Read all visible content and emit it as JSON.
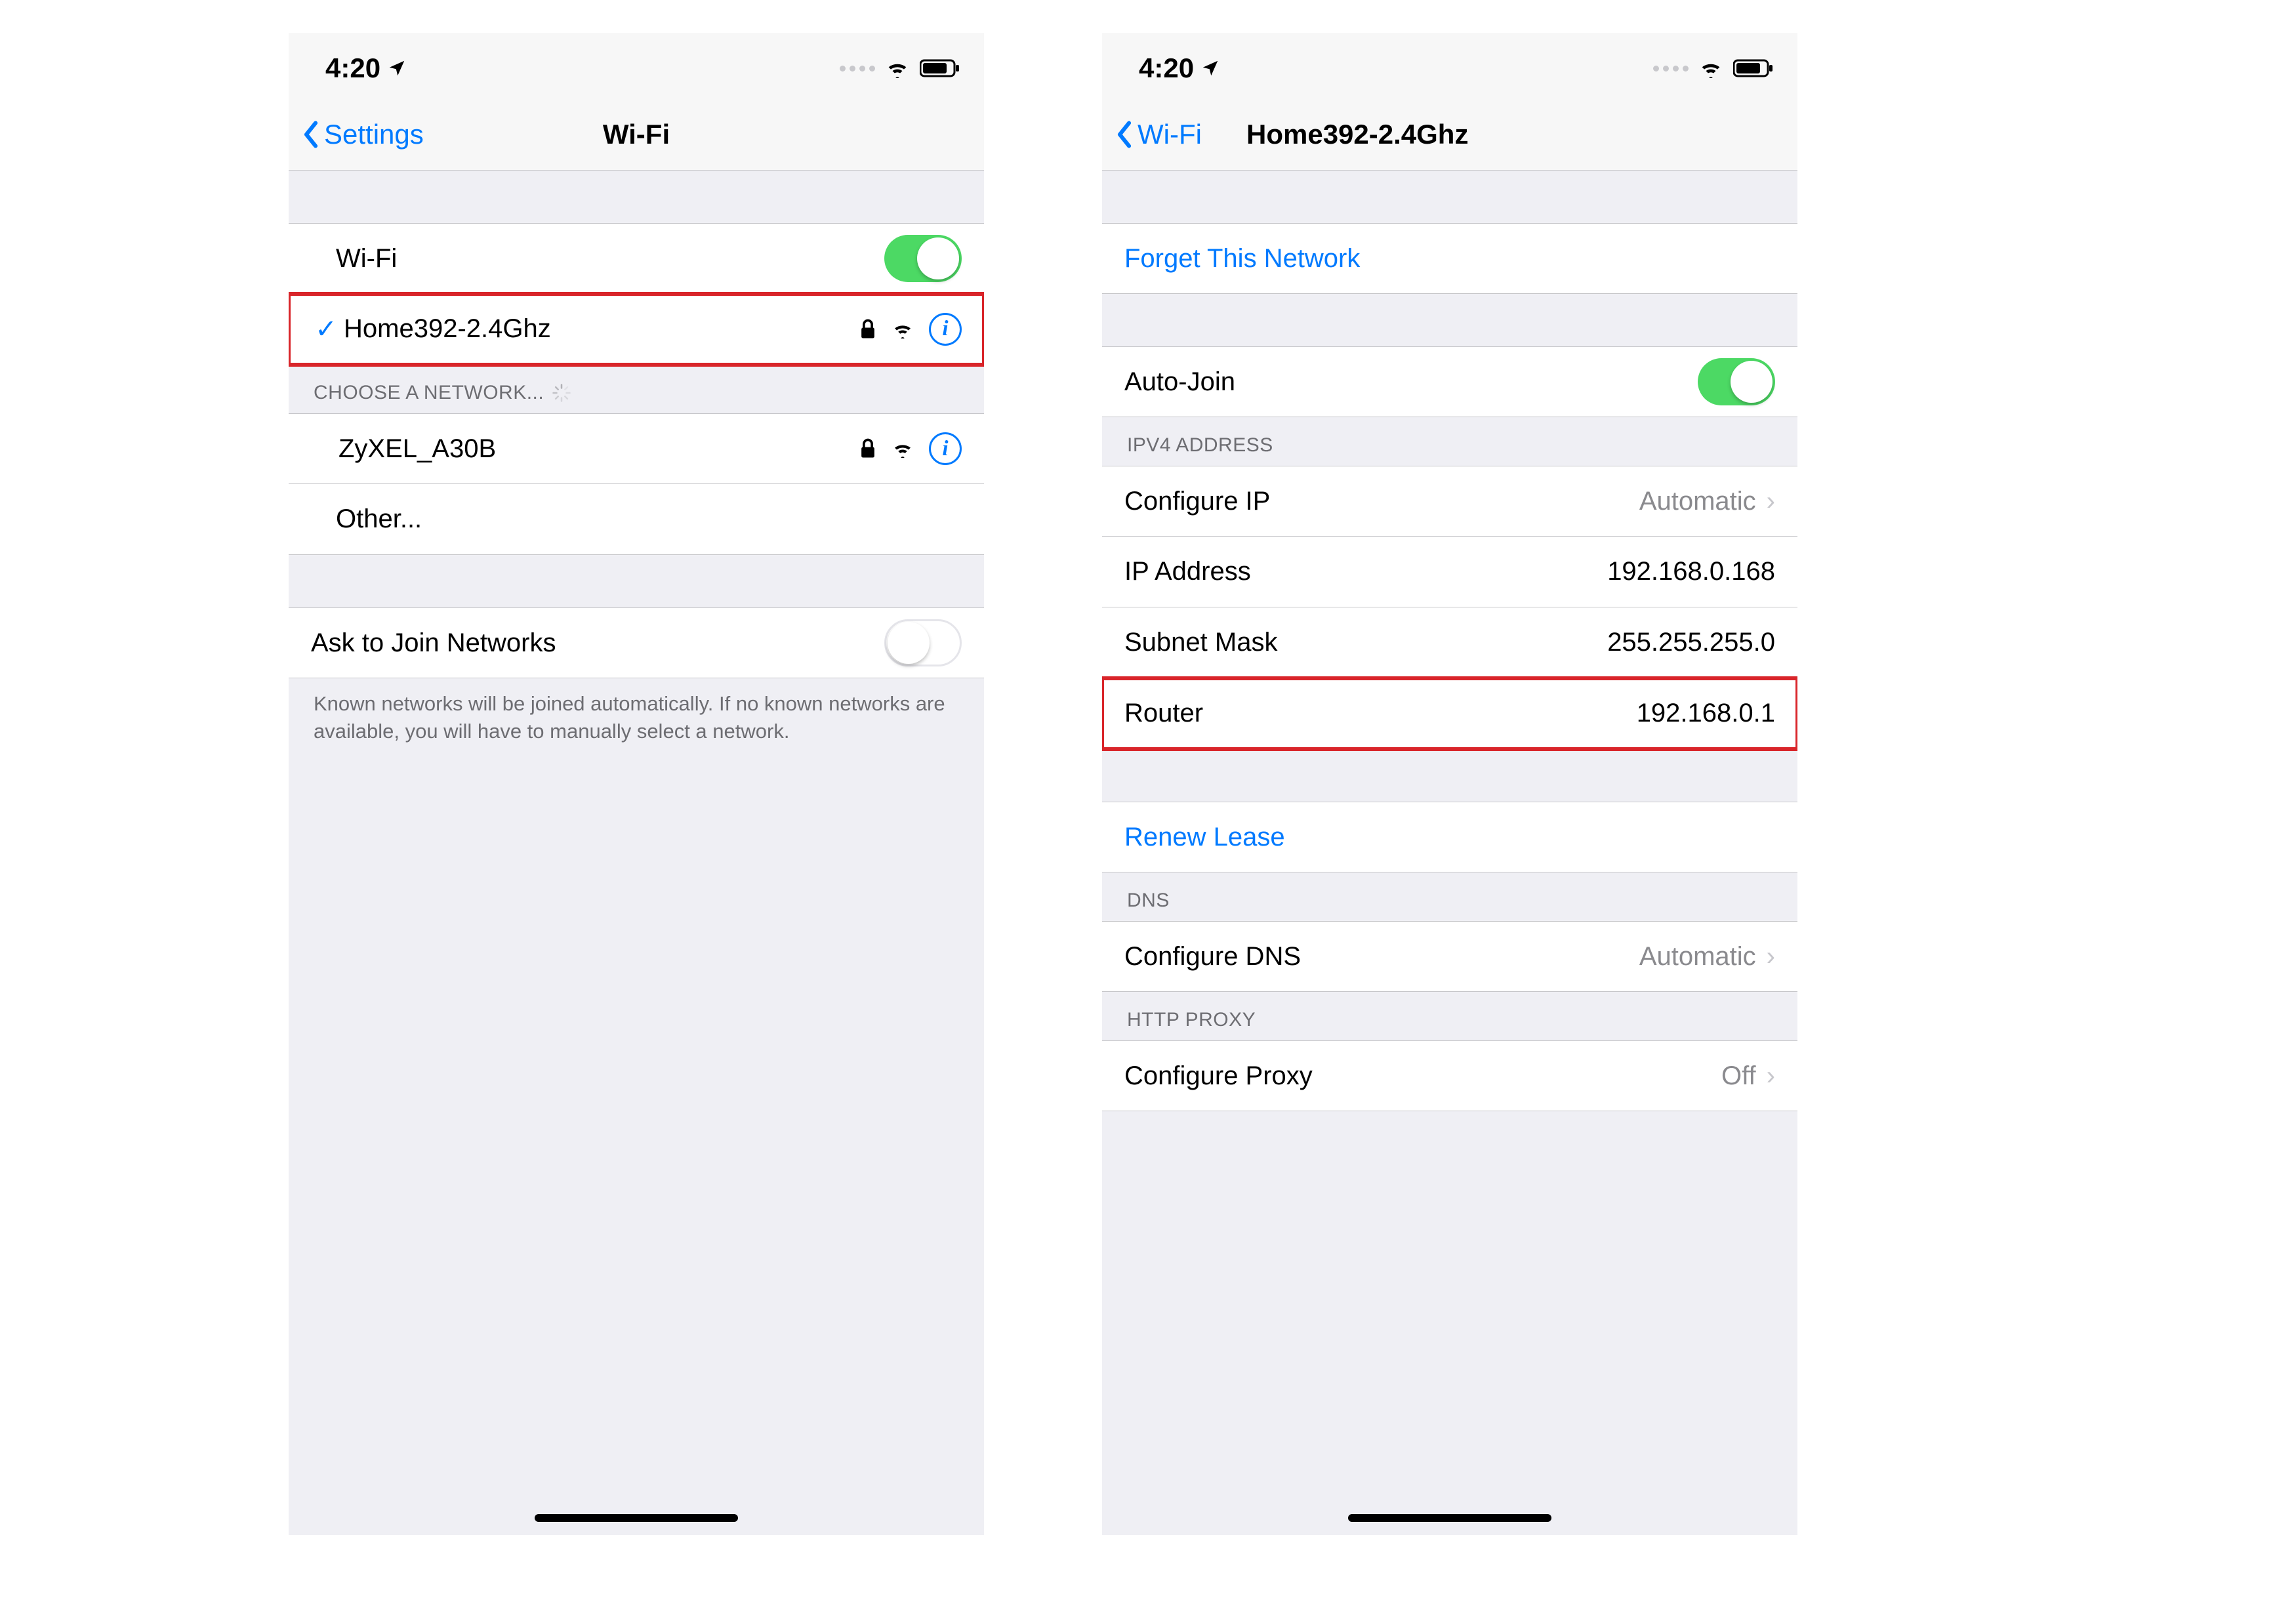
{
  "status": {
    "time": "4:20",
    "location_icon": "location-arrow",
    "wifi_icon": "wifi",
    "battery_icon": "battery"
  },
  "left": {
    "back_label": "Settings",
    "title": "Wi-Fi",
    "wifi_toggle_label": "Wi-Fi",
    "wifi_toggle_on": true,
    "connected_network": "Home392-2.4Ghz",
    "choose_header": "CHOOSE A NETWORK...",
    "networks": [
      {
        "name": "ZyXEL_A30B",
        "secure": true
      }
    ],
    "other_label": "Other...",
    "ask_label": "Ask to Join Networks",
    "ask_on": false,
    "ask_footer": "Known networks will be joined automatically. If no known networks are available, you will have to manually select a network."
  },
  "right": {
    "back_label": "Wi-Fi",
    "title": "Home392-2.4Ghz",
    "forget_label": "Forget This Network",
    "autojoin_label": "Auto-Join",
    "autojoin_on": true,
    "ipv4_header": "IPV4 ADDRESS",
    "configure_ip_label": "Configure IP",
    "configure_ip_value": "Automatic",
    "ip_label": "IP Address",
    "ip_value": "192.168.0.168",
    "subnet_label": "Subnet Mask",
    "subnet_value": "255.255.255.0",
    "router_label": "Router",
    "router_value": "192.168.0.1",
    "renew_label": "Renew Lease",
    "dns_header": "DNS",
    "configure_dns_label": "Configure DNS",
    "configure_dns_value": "Automatic",
    "proxy_header": "HTTP PROXY",
    "configure_proxy_label": "Configure Proxy",
    "configure_proxy_value": "Off"
  },
  "colors": {
    "link": "#007aff",
    "toggle_on": "#4cd964",
    "highlight": "#d9252a"
  }
}
